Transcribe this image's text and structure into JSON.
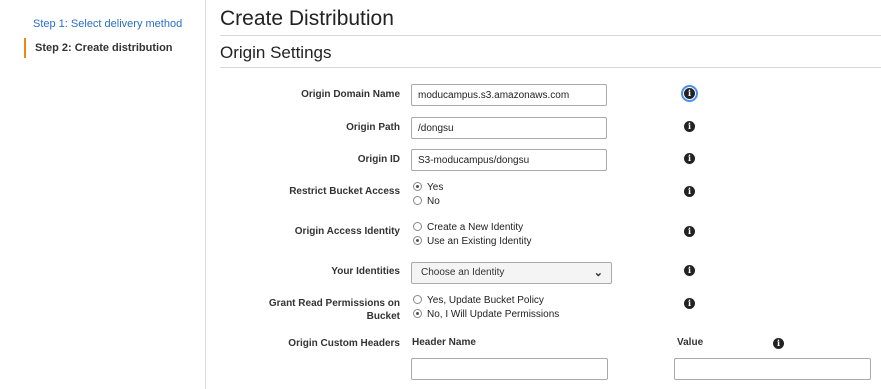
{
  "sidebar": {
    "steps": [
      {
        "label": "Step 1: Select delivery method"
      },
      {
        "label": "Step 2: Create distribution"
      }
    ]
  },
  "page": {
    "title": "Create Distribution",
    "section_title": "Origin Settings"
  },
  "form": {
    "origin_domain_name": {
      "label": "Origin Domain Name",
      "value": "moducampus.s3.amazonaws.com"
    },
    "origin_path": {
      "label": "Origin Path",
      "value": "/dongsu"
    },
    "origin_id": {
      "label": "Origin ID",
      "value": "S3-moducampus/dongsu"
    },
    "restrict_bucket_access": {
      "label": "Restrict Bucket Access",
      "options": [
        {
          "label": "Yes",
          "selected": true
        },
        {
          "label": "No",
          "selected": false
        }
      ]
    },
    "origin_access_identity": {
      "label": "Origin Access Identity",
      "options": [
        {
          "label": "Create a New Identity",
          "selected": false
        },
        {
          "label": "Use an Existing Identity",
          "selected": true
        }
      ]
    },
    "your_identities": {
      "label": "Your Identities",
      "selected": "Choose an Identity"
    },
    "grant_read_permissions": {
      "label": "Grant Read Permissions on Bucket",
      "options": [
        {
          "label": "Yes, Update Bucket Policy",
          "selected": false
        },
        {
          "label": "No, I Will Update Permissions",
          "selected": true
        }
      ]
    },
    "origin_custom_headers": {
      "label": "Origin Custom Headers",
      "header_name_label": "Header Name",
      "value_label": "Value"
    }
  },
  "icons": {
    "info": "info-icon",
    "dropdown": "chevron-down-icon"
  },
  "colors": {
    "link": "#2a6fc9",
    "active_step_border": "#e68a1c",
    "focus_outline": "#4d8ff0"
  }
}
